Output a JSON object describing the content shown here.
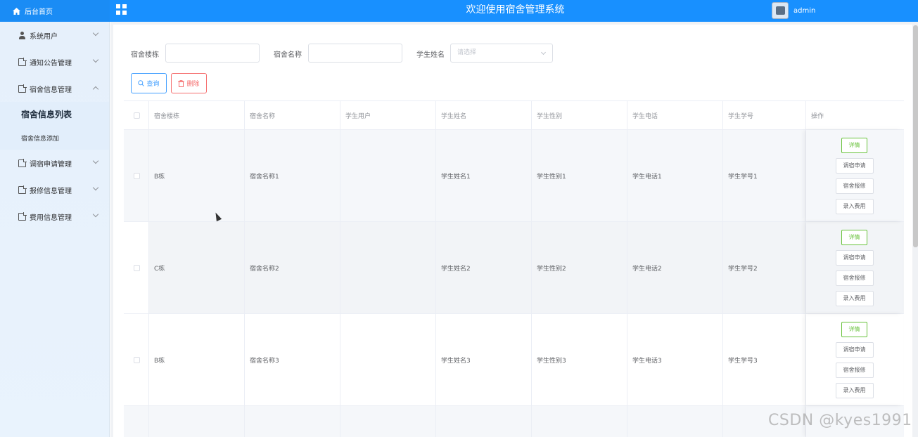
{
  "header": {
    "home_label": "后台首页",
    "title": "欢迎使用宿舍管理系统",
    "user": "admin"
  },
  "sidebar": {
    "items": [
      {
        "label": "系统用户",
        "icon": "user-icon"
      },
      {
        "label": "通知公告管理",
        "icon": "doc-icon"
      },
      {
        "label": "宿舍信息管理",
        "icon": "doc-icon",
        "expanded": true,
        "children": [
          {
            "label": "宿舍信息列表",
            "active": true
          },
          {
            "label": "宿舍信息添加"
          }
        ]
      },
      {
        "label": "调宿申请管理",
        "icon": "doc-icon"
      },
      {
        "label": "报修信息管理",
        "icon": "doc-icon"
      },
      {
        "label": "费用信息管理",
        "icon": "doc-icon"
      }
    ]
  },
  "search": {
    "building_label": "宿舍楼栋",
    "building_value": "",
    "name_label": "宿舍名称",
    "name_value": "",
    "student_label": "学生姓名",
    "student_placeholder": "请选择",
    "query_btn": "查询",
    "delete_btn": "删除"
  },
  "table": {
    "columns": [
      "宿舍楼栋",
      "宿舍名称",
      "学生用户",
      "学生姓名",
      "学生性别",
      "学生电话",
      "学生学号",
      "操作"
    ],
    "rows": [
      {
        "building": "B栋",
        "name": "宿舍名称1",
        "user": "",
        "student": "学生姓名1",
        "gender": "学生性别1",
        "phone": "学生电话1",
        "sid": "学生学号1"
      },
      {
        "building": "C栋",
        "name": "宿舍名称2",
        "user": "",
        "student": "学生姓名2",
        "gender": "学生性别2",
        "phone": "学生电话2",
        "sid": "学生学号2"
      },
      {
        "building": "B栋",
        "name": "宿舍名称3",
        "user": "",
        "student": "学生姓名3",
        "gender": "学生性别3",
        "phone": "学生电话3",
        "sid": "学生学号3"
      }
    ],
    "actions": [
      "详情",
      "调宿申请",
      "宿舍报修",
      "录入费用"
    ]
  },
  "watermark": "CSDN @kyes1991",
  "colors": {
    "header": "#1890ff",
    "detail": "#67c23a",
    "danger": "#f56c6c",
    "primary": "#409eff"
  }
}
